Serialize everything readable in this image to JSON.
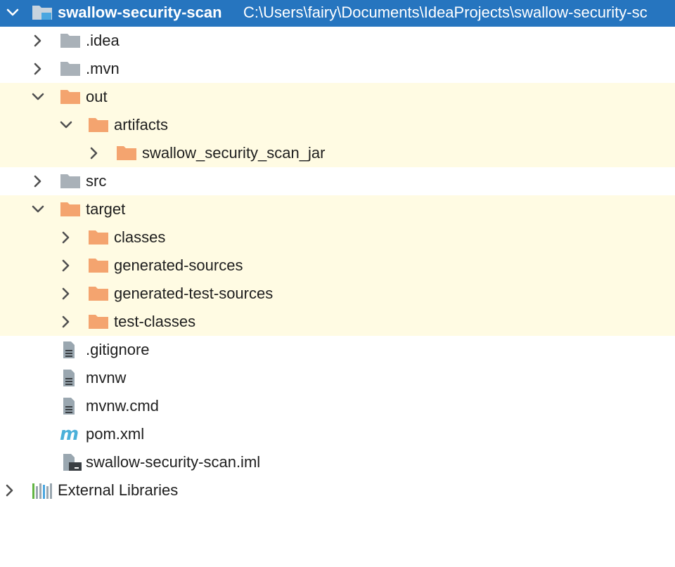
{
  "project_tree": {
    "root": {
      "name": "swallow-security-scan",
      "path": "C:\\Users\\fairy\\Documents\\IdeaProjects\\swallow-security-sc",
      "expanded": true
    },
    "items": [
      {
        "label": ".idea",
        "type": "folder",
        "excluded": false,
        "expanded": false
      },
      {
        "label": ".mvn",
        "type": "folder",
        "excluded": false,
        "expanded": false
      },
      {
        "label": "out",
        "type": "folder",
        "excluded": true,
        "expanded": true
      },
      {
        "label": "artifacts",
        "type": "folder",
        "excluded": true,
        "expanded": true
      },
      {
        "label": "swallow_security_scan_jar",
        "type": "folder",
        "excluded": true,
        "expanded": false
      },
      {
        "label": "src",
        "type": "folder",
        "excluded": false,
        "expanded": false
      },
      {
        "label": "target",
        "type": "folder",
        "excluded": true,
        "expanded": true
      },
      {
        "label": "classes",
        "type": "folder",
        "excluded": true,
        "expanded": false
      },
      {
        "label": "generated-sources",
        "type": "folder",
        "excluded": true,
        "expanded": false
      },
      {
        "label": "generated-test-sources",
        "type": "folder",
        "excluded": true,
        "expanded": false
      },
      {
        "label": "test-classes",
        "type": "folder",
        "excluded": true,
        "expanded": false
      },
      {
        "label": ".gitignore",
        "type": "text-file"
      },
      {
        "label": "mvnw",
        "type": "text-file"
      },
      {
        "label": "mvnw.cmd",
        "type": "text-file"
      },
      {
        "label": "pom.xml",
        "type": "maven-file"
      },
      {
        "label": "swallow-security-scan.iml",
        "type": "module-file"
      },
      {
        "label": "External Libraries",
        "type": "libraries",
        "expanded": false
      }
    ]
  },
  "colors": {
    "selection": "#2675bf",
    "excluded_background": "#fffbe3",
    "regular_folder": "#a9b1b8",
    "excluded_folder": "#f4a46f",
    "maven": "#4bb0d9"
  },
  "icons": {
    "arrow_collapsed": "chevron-right-icon",
    "arrow_expanded": "chevron-down-icon"
  }
}
